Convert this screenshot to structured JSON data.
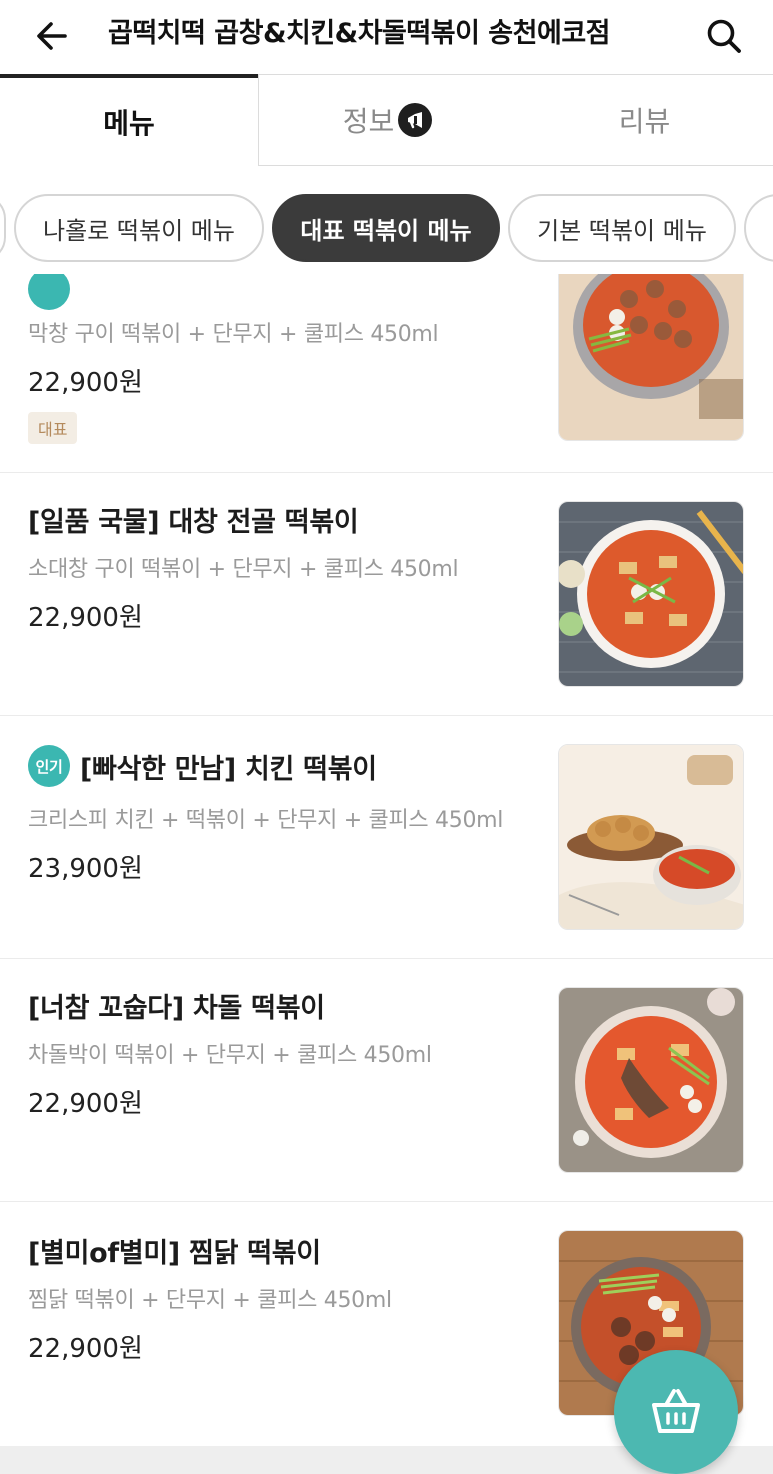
{
  "header": {
    "title": "곱떡치떡 곱창&치킨&차돌떡볶이 송천에코점",
    "back_icon": "arrow-left-icon",
    "search_icon": "search-icon"
  },
  "tabs": [
    {
      "label": "메뉴",
      "active": true
    },
    {
      "label": "정보",
      "icon": "megaphone-icon"
    },
    {
      "label": "리뷰"
    }
  ],
  "categories": [
    {
      "label": "나홀로 떡볶이 메뉴"
    },
    {
      "label": "대표 떡볶이 메뉴",
      "active": true
    },
    {
      "label": "기본 떡볶이 메뉴"
    }
  ],
  "menu_items": [
    {
      "name": "",
      "description": "막창 구이 떡볶이 + 단무지 + 쿨피스 450ml",
      "price": "22,900원",
      "badge": "대표"
    },
    {
      "name": "[일품 국물] 대창 전골 떡볶이",
      "description": "소대창 구이 떡볶이 + 단무지 + 쿨피스 450ml",
      "price": "22,900원"
    },
    {
      "name": "[빠삭한 만남] 치킨 떡볶이",
      "hot_label": "인기",
      "description": "크리스피 치킨 + 떡볶이 + 단무지 + 쿨피스 450ml",
      "price": "23,900원"
    },
    {
      "name": "[너참 꼬숩다] 차돌 떡볶이",
      "description": "차돌박이 떡볶이 + 단무지 + 쿨피스 450ml",
      "price": "22,900원"
    },
    {
      "name": "[별미of별미] 찜닭 떡볶이",
      "description": "찜닭 떡볶이 + 단무지 + 쿨피스 450ml",
      "price": "22,900원"
    }
  ],
  "cart": {
    "icon": "shopping-basket-icon"
  },
  "colors": {
    "accent": "#4cb8b1",
    "chip_active": "#3b3b3b",
    "badge_bg": "#f3ede4"
  }
}
